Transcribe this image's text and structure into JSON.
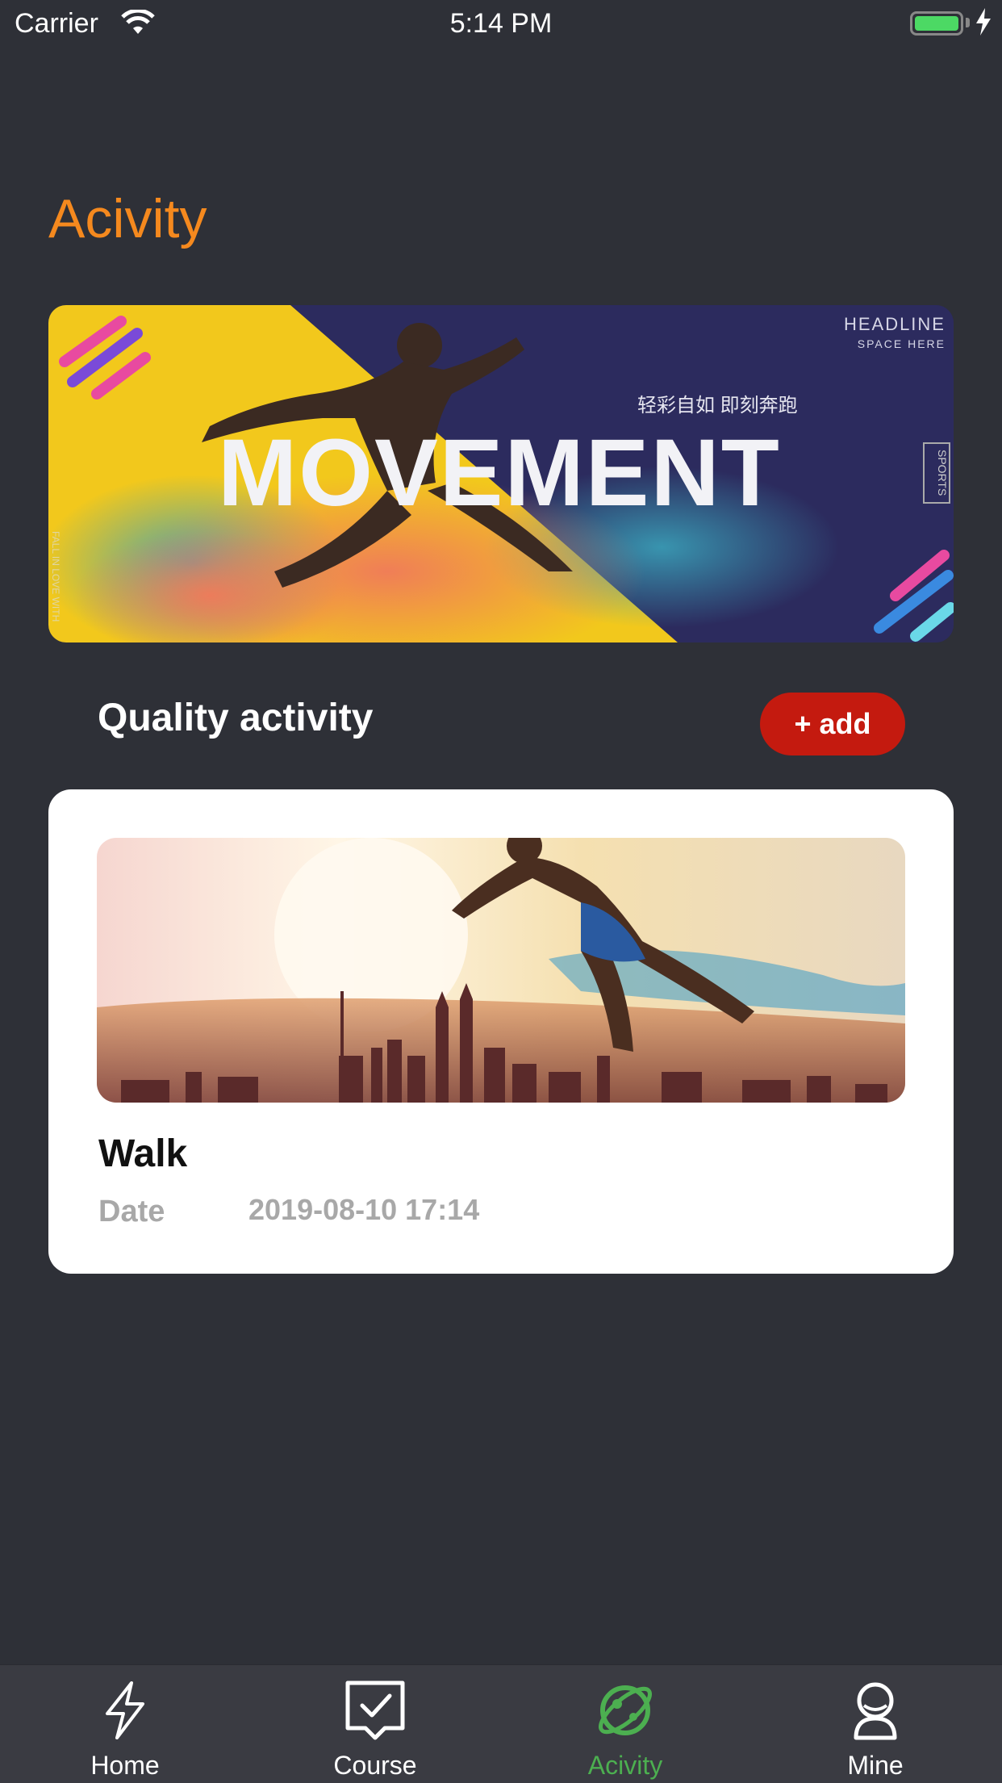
{
  "status_bar": {
    "carrier": "Carrier",
    "time": "5:14 PM"
  },
  "page": {
    "title": "Acivity"
  },
  "banner": {
    "headline": "HEADLINE",
    "headline_sub": "SPACE HERE",
    "chinese_text": "轻彩自如 即刻奔跑",
    "main_word": "MOVEMENT",
    "side_tag": "SPORTS",
    "side_text": "FALL IN LOVE WITH"
  },
  "section": {
    "title": "Quality activity",
    "add_label": "+ add"
  },
  "activities": [
    {
      "name": "Walk",
      "date_label": "Date",
      "date_value": "2019-08-10 17:14"
    }
  ],
  "tabbar": {
    "items": [
      {
        "label": "Home",
        "icon": "lightning-icon",
        "active": false
      },
      {
        "label": "Course",
        "icon": "checklist-icon",
        "active": false
      },
      {
        "label": "Acivity",
        "icon": "planet-icon",
        "active": true
      },
      {
        "label": "Mine",
        "icon": "person-icon",
        "active": false
      }
    ]
  },
  "colors": {
    "background": "#2e3037",
    "title_orange": "#f5891e",
    "add_button_red": "#c41a0f",
    "active_tab_green": "#4caf50"
  }
}
